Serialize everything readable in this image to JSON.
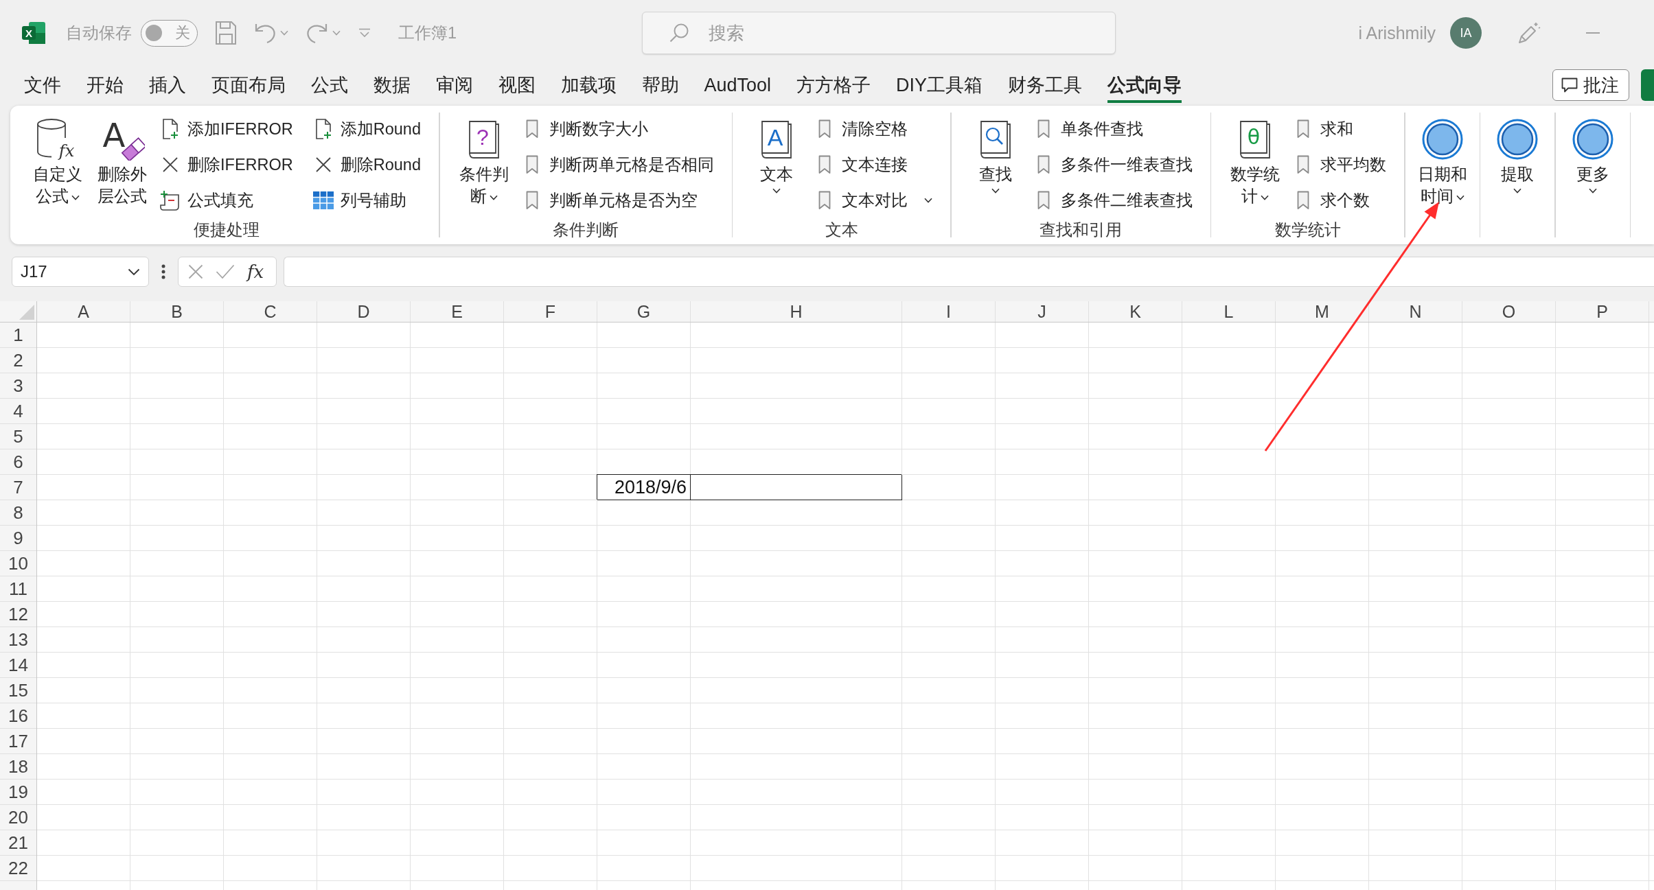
{
  "title_bar": {
    "logo_glyph": "X",
    "autosave": {
      "label": "自动保存",
      "on": false,
      "state_label": "关"
    },
    "quick_access": [
      {
        "kind": "save",
        "dropdown": false
      },
      {
        "kind": "undo",
        "dropdown": true
      },
      {
        "kind": "redo",
        "dropdown": true
      },
      {
        "kind": "customize",
        "dropdown": false
      }
    ],
    "document_title": "工作簿1",
    "search": {
      "placeholder": "搜索"
    },
    "account": {
      "name": "i Arishmily",
      "initials": "IA"
    },
    "window_controls": [
      {
        "kind": "pen"
      },
      {
        "kind": "minimize"
      }
    ]
  },
  "menu_tabs": [
    {
      "label": "文件",
      "selected": false
    },
    {
      "label": "开始",
      "selected": false
    },
    {
      "label": "插入",
      "selected": false
    },
    {
      "label": "页面布局",
      "selected": false
    },
    {
      "label": "公式",
      "selected": false
    },
    {
      "label": "数据",
      "selected": false
    },
    {
      "label": "审阅",
      "selected": false
    },
    {
      "label": "视图",
      "selected": false
    },
    {
      "label": "加载项",
      "selected": false
    },
    {
      "label": "帮助",
      "selected": false
    },
    {
      "label": "AudTool",
      "selected": false
    },
    {
      "label": "方方格子",
      "selected": false
    },
    {
      "label": "DIY工具箱",
      "selected": false
    },
    {
      "label": "财务工具",
      "selected": false
    },
    {
      "label": "公式向导",
      "selected": true
    }
  ],
  "menu_actions": [
    {
      "kind": "comments",
      "label": "批注"
    },
    {
      "kind": "share"
    }
  ],
  "ribbon": {
    "groups": [
      {
        "label": "便捷处理",
        "large": [
          {
            "label": "自定义公式",
            "kind": "cylinder",
            "glyph": "fx",
            "dropdown": true
          },
          {
            "label": "删除外层公式",
            "kind": "eraser",
            "glyph": "A",
            "dropdown": false
          }
        ],
        "small_columns": [
          [
            {
              "label": "添加IFERROR",
              "kind": "add",
              "dropdown": false
            },
            {
              "label": "删除IFERROR",
              "kind": "remove",
              "dropdown": false
            },
            {
              "label": "公式填充",
              "kind": "fill",
              "dropdown": false
            }
          ],
          [
            {
              "label": "添加Round",
              "kind": "add",
              "dropdown": false
            },
            {
              "label": "删除Round",
              "kind": "remove",
              "dropdown": false
            },
            {
              "label": "列号辅助",
              "kind": "grid",
              "dropdown": false
            }
          ]
        ]
      },
      {
        "label": "条件判断",
        "large": [
          {
            "label": "条件判断",
            "kind": "question",
            "glyph": "?",
            "dropdown": true
          }
        ],
        "small_columns": [
          [
            {
              "label": "判断数字大小",
              "kind": "bookmark",
              "dropdown": false
            },
            {
              "label": "判断两单元格是否相同",
              "kind": "bookmark",
              "dropdown": false
            },
            {
              "label": "判断单元格是否为空",
              "kind": "bookmark",
              "dropdown": false
            }
          ]
        ]
      },
      {
        "label": "文本",
        "large": [
          {
            "label": "文本",
            "kind": "letter",
            "glyph": "A",
            "dropdown": true
          }
        ],
        "small_columns": [
          [
            {
              "label": "清除空格",
              "kind": "bookmark",
              "dropdown": false
            },
            {
              "label": "文本连接",
              "kind": "bookmark",
              "dropdown": false
            },
            {
              "label": "文本对比",
              "kind": "bookmark",
              "dropdown": true
            }
          ]
        ]
      },
      {
        "label": "查找和引用",
        "large": [
          {
            "label": "查找",
            "kind": "magnifier",
            "dropdown": true
          }
        ],
        "small_columns": [
          [
            {
              "label": "单条件查找",
              "kind": "bookmark",
              "dropdown": false
            },
            {
              "label": "多条件一维表查找",
              "kind": "bookmark",
              "dropdown": false
            },
            {
              "label": "多条件二维表查找",
              "kind": "bookmark",
              "dropdown": false
            }
          ]
        ]
      },
      {
        "label": "数学统计",
        "large": [
          {
            "label": "数学统计",
            "kind": "theta",
            "glyph": "θ",
            "dropdown": true
          }
        ],
        "small_columns": [
          [
            {
              "label": "求和",
              "kind": "bookmark",
              "dropdown": false
            },
            {
              "label": "求平均数",
              "kind": "bookmark",
              "dropdown": false
            },
            {
              "label": "求个数",
              "kind": "bookmark",
              "dropdown": false
            }
          ]
        ]
      },
      {
        "large": [
          {
            "label": "日期和时间",
            "kind": "circle",
            "dropdown": true
          }
        ]
      },
      {
        "large": [
          {
            "label": "提取",
            "kind": "circle",
            "dropdown": true
          }
        ]
      },
      {
        "large": [
          {
            "label": "更多",
            "kind": "circle",
            "dropdown": true
          }
        ]
      }
    ]
  },
  "formula_bar": {
    "name_box": "J17",
    "cancel": {
      "disabled": true
    },
    "enter": {
      "disabled": true
    },
    "function_glyph": "fx"
  },
  "sheet": {
    "columns": [
      "A",
      "B",
      "C",
      "D",
      "E",
      "F",
      "G",
      "H",
      "I",
      "J",
      "K",
      "L",
      "M",
      "N",
      "O",
      "P"
    ],
    "rows": [
      {
        "label": "1"
      },
      {
        "label": "2"
      },
      {
        "label": "3"
      },
      {
        "label": "4"
      },
      {
        "label": "5"
      },
      {
        "label": "6"
      },
      {
        "label": "7",
        "cells": [
          {
            "bordered": false
          },
          {
            "bordered": false
          },
          {
            "bordered": false
          },
          {
            "bordered": false
          },
          {
            "bordered": false
          },
          {
            "bordered": false
          },
          {
            "value": "2018/9/6",
            "bordered": true
          },
          {
            "bordered": true
          }
        ]
      },
      {
        "label": "8"
      },
      {
        "label": "9"
      },
      {
        "label": "10"
      },
      {
        "label": "11"
      },
      {
        "label": "12"
      },
      {
        "label": "13"
      },
      {
        "label": "14"
      },
      {
        "label": "15"
      },
      {
        "label": "16"
      },
      {
        "label": "17"
      },
      {
        "label": "18"
      },
      {
        "label": "19"
      },
      {
        "label": "20"
      },
      {
        "label": "21"
      },
      {
        "label": "22"
      }
    ]
  },
  "annotations": [
    {
      "kind": "arrow"
    }
  ]
}
